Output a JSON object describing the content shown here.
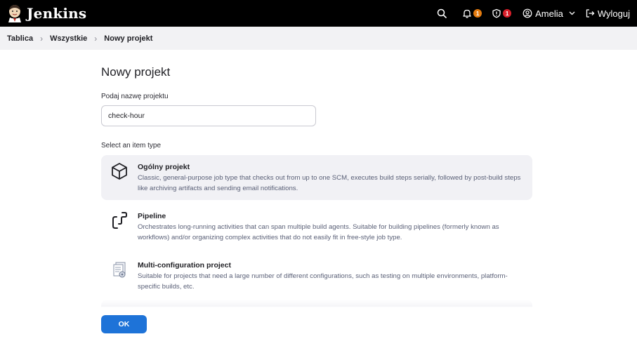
{
  "header": {
    "app_name": "Jenkins",
    "notifications_count": "1",
    "security_count": "1",
    "user_name": "Amelia",
    "logout_label": "Wyloguj"
  },
  "breadcrumb": {
    "items": [
      "Tablica",
      "Wszystkie",
      "Nowy projekt"
    ]
  },
  "page": {
    "title": "Nowy projekt",
    "name_label": "Podaj nazwę projektu",
    "name_value": "check-hour",
    "type_label": "Select an item type"
  },
  "item_types": [
    {
      "title": "Ogólny projekt",
      "description": "Classic, general-purpose job type that checks out from up to one SCM, executes build steps serially, followed by post-build steps like archiving artifacts and sending email notifications.",
      "icon": "package-icon",
      "selected": true
    },
    {
      "title": "Pipeline",
      "description": "Orchestrates long-running activities that can span multiple build agents. Suitable for building pipelines (formerly known as workflows) and/or organizing complex activities that do not easily fit in free-style job type.",
      "icon": "pipeline-icon",
      "selected": false
    },
    {
      "title": "Multi-configuration project",
      "description": "Suitable for projects that need a large number of different configurations, such as testing on multiple environments, platform-specific builds, etc.",
      "icon": "multi-config-icon",
      "selected": false
    }
  ],
  "actions": {
    "ok_label": "OK"
  },
  "colors": {
    "topbar": "#000000",
    "primary": "#1e73d8",
    "notification_badge": "#e47b0f",
    "security_badge": "#d91f2a"
  }
}
